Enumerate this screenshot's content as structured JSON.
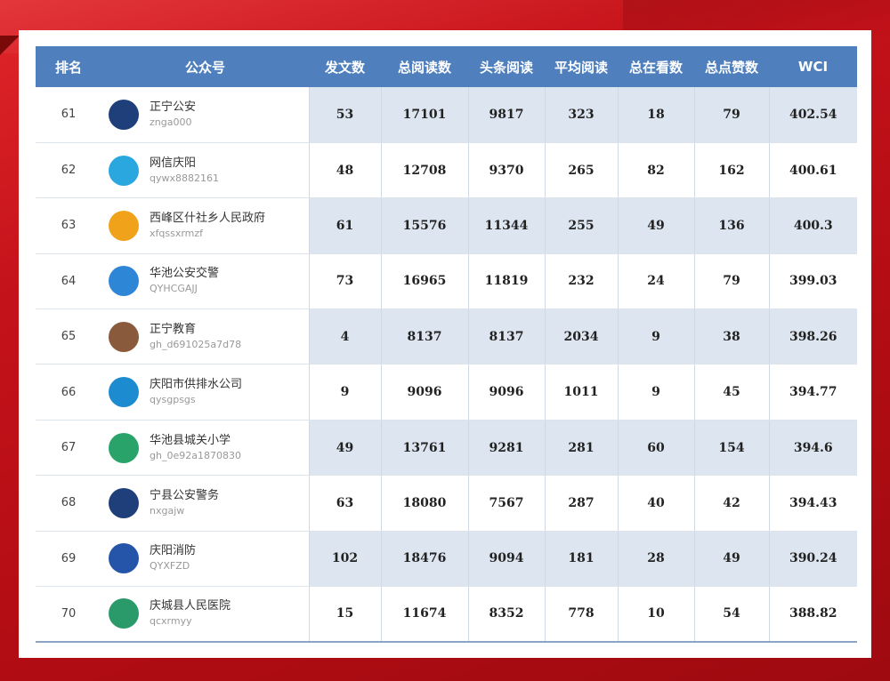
{
  "table": {
    "headers": {
      "rank": "排名",
      "account": "公众号",
      "posts": "发文数",
      "total_reads": "总阅读数",
      "headline_reads": "头条阅读",
      "avg_reads": "平均阅读",
      "watching": "总在看数",
      "likes": "总点赞数",
      "wci": "WCI"
    },
    "rows": [
      {
        "rank": "61",
        "name": "正宁公安",
        "id": "znga000",
        "posts": "53",
        "total_reads": "17101",
        "headline_reads": "9817",
        "avg_reads": "323",
        "watching": "18",
        "likes": "79",
        "wci": "402.54",
        "logo_icon": "police-badge-icon",
        "logo_color": "#1f3f7a"
      },
      {
        "rank": "62",
        "name": "网信庆阳",
        "id": "qywx8882161",
        "posts": "48",
        "total_reads": "12708",
        "headline_reads": "9370",
        "avg_reads": "265",
        "watching": "82",
        "likes": "162",
        "wci": "400.61",
        "logo_icon": "hexagon-logo-icon",
        "logo_color": "#2aa7df"
      },
      {
        "rank": "63",
        "name": "西峰区什社乡人民政府",
        "id": "xfqssxrmzf",
        "posts": "61",
        "total_reads": "15576",
        "headline_reads": "11344",
        "avg_reads": "255",
        "watching": "49",
        "likes": "136",
        "wci": "400.3",
        "logo_icon": "government-emblem-icon",
        "logo_color": "#f0a21a"
      },
      {
        "rank": "64",
        "name": "华池公安交警",
        "id": "QYHCGAJJ",
        "posts": "73",
        "total_reads": "16965",
        "headline_reads": "11819",
        "avg_reads": "232",
        "watching": "24",
        "likes": "79",
        "wci": "399.03",
        "logo_icon": "traffic-police-icon",
        "logo_color": "#2e86d6"
      },
      {
        "rank": "65",
        "name": "正宁教育",
        "id": "gh_d691025a7d78",
        "posts": "4",
        "total_reads": "8137",
        "headline_reads": "8137",
        "avg_reads": "2034",
        "watching": "9",
        "likes": "38",
        "wci": "398.26",
        "logo_icon": "school-building-icon",
        "logo_color": "#8a5a3c"
      },
      {
        "rank": "66",
        "name": "庆阳市供排水公司",
        "id": "qysgpsgs",
        "posts": "9",
        "total_reads": "9096",
        "headline_reads": "9096",
        "avg_reads": "1011",
        "watching": "9",
        "likes": "45",
        "wci": "394.77",
        "logo_icon": "water-company-icon",
        "logo_color": "#1c8bd0"
      },
      {
        "rank": "67",
        "name": "华池县城关小学",
        "id": "gh_0e92a1870830",
        "posts": "49",
        "total_reads": "13761",
        "headline_reads": "9281",
        "avg_reads": "281",
        "watching": "60",
        "likes": "154",
        "wci": "394.6",
        "logo_icon": "school-emblem-icon",
        "logo_color": "#2aa36a"
      },
      {
        "rank": "68",
        "name": "宁县公安警务",
        "id": "nxgajw",
        "posts": "63",
        "total_reads": "18080",
        "headline_reads": "7567",
        "avg_reads": "287",
        "watching": "40",
        "likes": "42",
        "wci": "394.43",
        "logo_icon": "police-badge-icon",
        "logo_color": "#1f3f7a"
      },
      {
        "rank": "69",
        "name": "庆阳消防",
        "id": "QYXFZD",
        "posts": "102",
        "total_reads": "18476",
        "headline_reads": "9094",
        "avg_reads": "181",
        "watching": "28",
        "likes": "49",
        "wci": "390.24",
        "logo_icon": "fire-rescue-icon",
        "logo_color": "#2555a8"
      },
      {
        "rank": "70",
        "name": "庆城县人民医院",
        "id": "qcxrmyy",
        "posts": "15",
        "total_reads": "11674",
        "headline_reads": "8352",
        "avg_reads": "778",
        "watching": "10",
        "likes": "54",
        "wci": "388.82",
        "logo_icon": "hospital-emblem-icon",
        "logo_color": "#2a9a6a"
      }
    ]
  }
}
